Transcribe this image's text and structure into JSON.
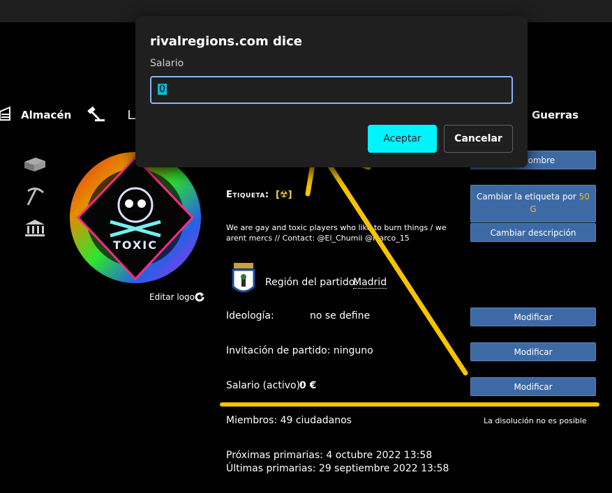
{
  "nav": {
    "warehouse_label": "Almacén",
    "wars_label": "Guerras"
  },
  "party": {
    "rename_button": "ar nombre",
    "tag_label": "Etiqueta:",
    "tag_value": "[☢]",
    "change_tag_button_prefix": "Cambiar la etiqueta por",
    "change_tag_amount": "50",
    "change_tag_currency": "G",
    "description": "We are gay and toxic players who like to burn things / we arent mercs // Contact: @El_Chumii @Marco_15",
    "change_description_button": "Cambiar descripción",
    "region_label": "Región del partido:",
    "region_value": "Madrid",
    "ideology_label": "Ideología:",
    "ideology_value": "no se define",
    "invitation_label": "Invitación de partido: ninguno",
    "salary_label": "Salario (activo):",
    "salary_value": "0 €",
    "modify_button": "Modificar",
    "members": "Miembros: 49 ciudadanos",
    "dissolution": "La disolución no es posible",
    "next_primaries": "Próximas primarias: 4 octubre 2022 13:58",
    "last_primaries": "Últimas primarias: 29 septiembre 2022 13:58",
    "edit_logo": "Editar logo",
    "logo_text": "TOXIC"
  },
  "dialog": {
    "title": "rivalregions.com dice",
    "label": "Salario",
    "input_value": "0",
    "accept": "Aceptar",
    "cancel": "Cancelar"
  },
  "colors": {
    "button_blue": "#3d6aa5",
    "accept_cyan": "#00f3ff",
    "annotation_yellow": "#f5c400",
    "input_border": "#8ab4f8"
  }
}
